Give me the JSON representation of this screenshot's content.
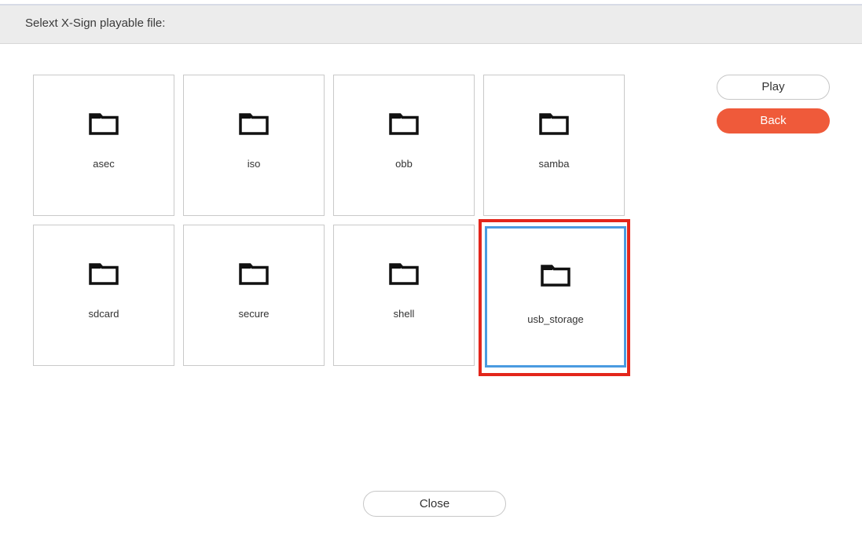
{
  "header": {
    "title": "Selext X-Sign playable file:"
  },
  "folders": [
    {
      "label": "asec",
      "icon": "folder-icon"
    },
    {
      "label": "iso",
      "icon": "folder-icon"
    },
    {
      "label": "obb",
      "icon": "folder-icon"
    },
    {
      "label": "samba",
      "icon": "folder-icon"
    },
    {
      "label": "sdcard",
      "icon": "folder-icon"
    },
    {
      "label": "secure",
      "icon": "folder-icon"
    },
    {
      "label": "shell",
      "icon": "folder-icon"
    },
    {
      "label": "usb_storage",
      "icon": "folder-icon"
    }
  ],
  "selected_folder": "usb_storage",
  "actions": {
    "play_label": "Play",
    "back_label": "Back"
  },
  "footer": {
    "close_label": "Close"
  },
  "colors": {
    "back_button": "#ef5a3a",
    "selection_border": "#4a9be0",
    "highlight_annotation": "#e3261b",
    "header_background": "#ececec"
  }
}
